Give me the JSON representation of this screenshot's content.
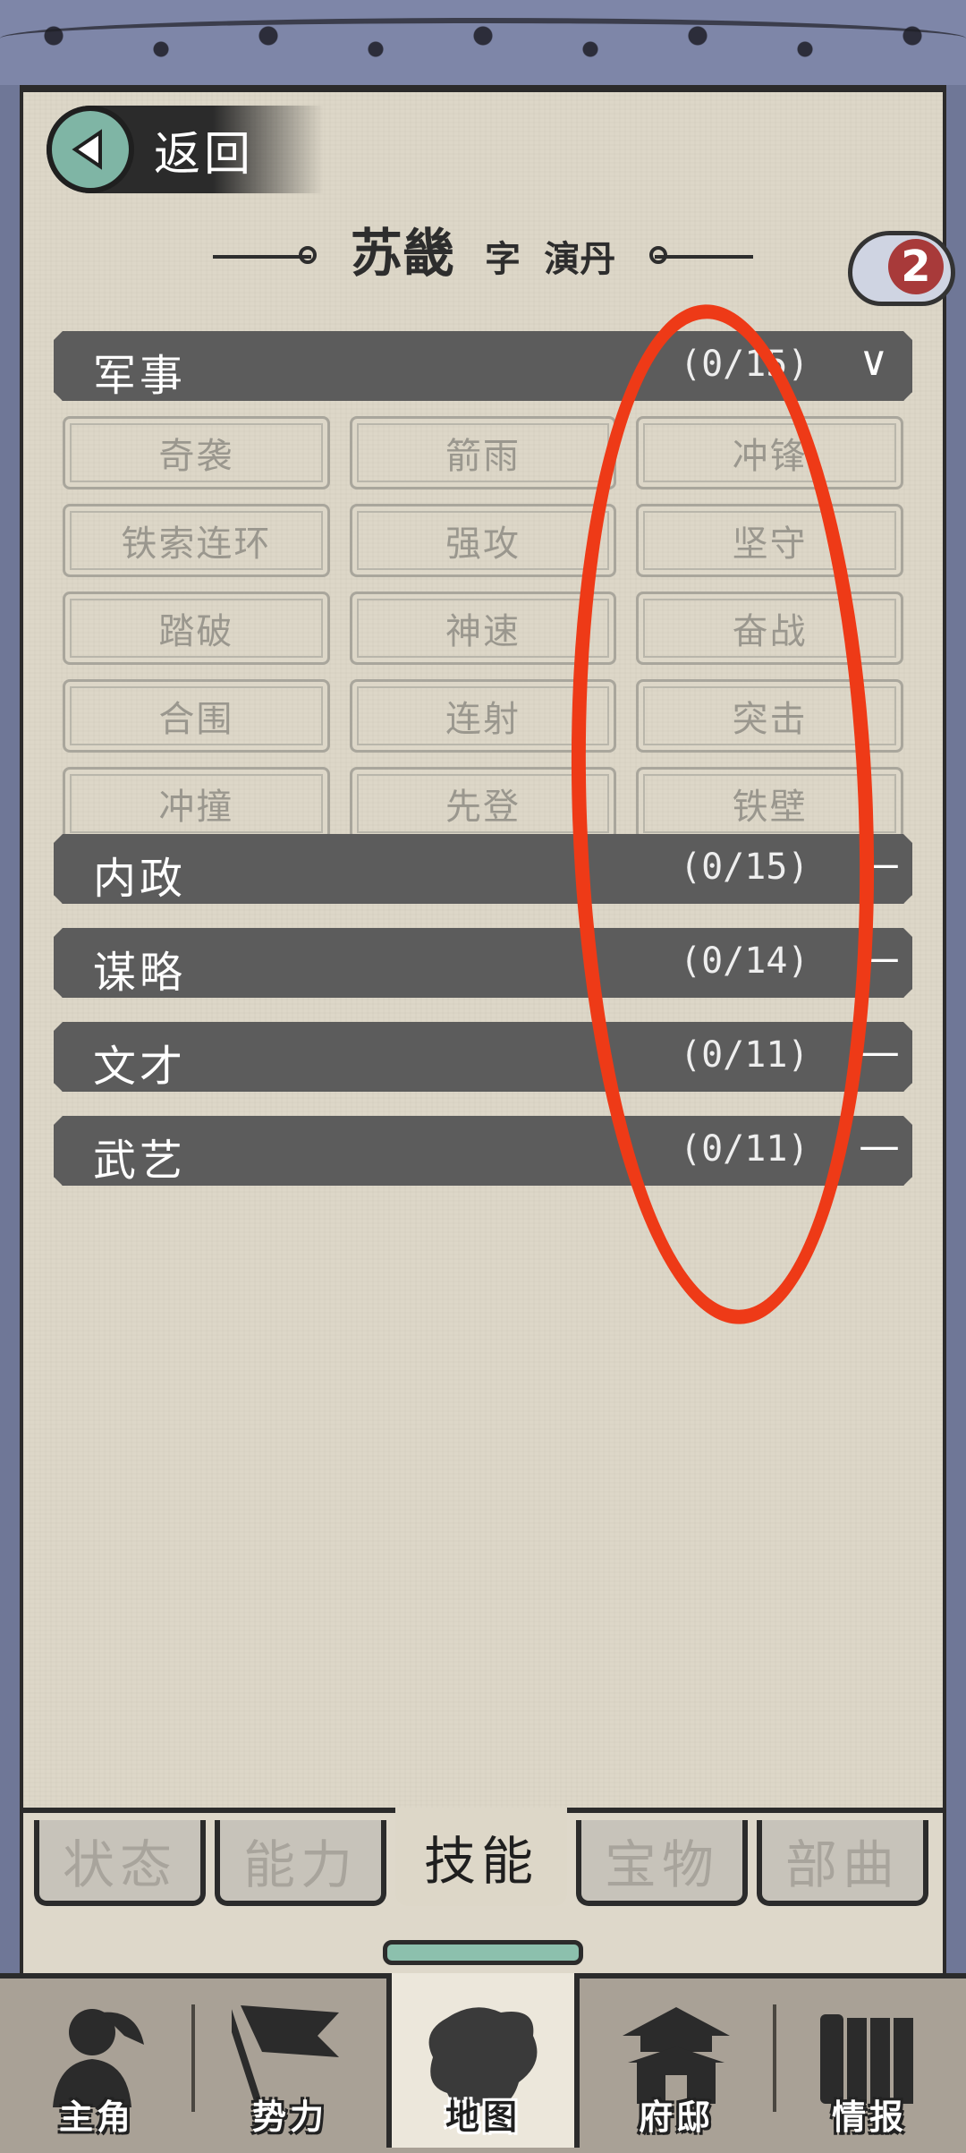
{
  "back": {
    "label": "返回"
  },
  "title": {
    "name": "苏畿",
    "zi_label": "字",
    "courtesy_name": "演丹"
  },
  "badge": {
    "count": "2"
  },
  "categories": [
    {
      "name": "军事",
      "count": "(0/15)",
      "toggle": "∨"
    },
    {
      "name": "内政",
      "count": "(0/15)",
      "toggle": "—"
    },
    {
      "name": "谋略",
      "count": "(0/14)",
      "toggle": "—"
    },
    {
      "name": "文才",
      "count": "(0/11)",
      "toggle": "—"
    },
    {
      "name": "武艺",
      "count": "(0/11)",
      "toggle": "—"
    }
  ],
  "military_skills": [
    "奇袭",
    "箭雨",
    "冲锋",
    "铁索连环",
    "强攻",
    "坚守",
    "踏破",
    "神速",
    "奋战",
    "合围",
    "连射",
    "突击",
    "冲撞",
    "先登",
    "铁壁"
  ],
  "tabs": [
    "状态",
    "能力",
    "技能",
    "宝物",
    "部曲"
  ],
  "active_tab": "技能",
  "nav": [
    "主角",
    "势力",
    "地图",
    "府邸",
    "情报"
  ],
  "active_nav": "地图",
  "annotation_color": "#ee3a17"
}
